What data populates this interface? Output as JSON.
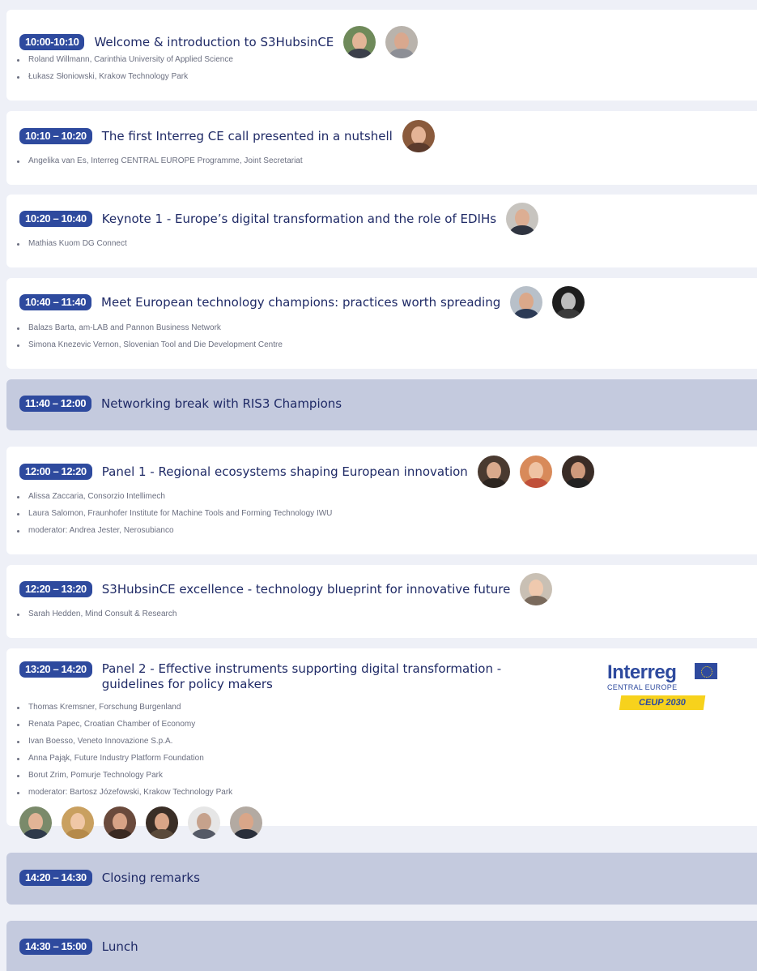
{
  "colors": {
    "accent": "#2e4a9e",
    "title": "#1f2a66",
    "break_bg": "#c4cade",
    "page_bg": "#eef0f7",
    "logo_yellow": "#f7d21c"
  },
  "sessions": [
    {
      "time": "10:00-10:10",
      "title": "Welcome & introduction to S3HubsinCE",
      "speakers": [
        "Roland Willmann, Carinthia University of Applied Science",
        "Łukasz Słoniowski, Krakow Technology Park"
      ]
    },
    {
      "time": "10:10 – 10:20",
      "title": "The first Interreg CE call presented in a nutshell",
      "speakers": [
        "Angelika van Es, Interreg CENTRAL EUROPE Programme, Joint Secretariat"
      ]
    },
    {
      "time": "10:20 – 10:40",
      "title": "Keynote 1 - Europe’s digital transformation and the role of EDIHs",
      "speakers": [
        "Mathias Kuom DG Connect"
      ]
    },
    {
      "time": "10:40 – 11:40",
      "title": "Meet European technology champions: practices worth spreading",
      "speakers": [
        "Balazs Barta, am-LAB and Pannon Business Network",
        "Simona Knezevic Vernon, Slovenian Tool and Die Development Centre"
      ]
    },
    {
      "time": "11:40 – 12:00",
      "title": "Networking break with RIS3 Champions",
      "speakers": []
    },
    {
      "time": "12:00 – 12:20",
      "title": "Panel 1 - Regional ecosystems shaping European innovation",
      "speakers": [
        "Alissa Zaccaria, Consorzio Intellimech",
        "Laura Salomon, Fraunhofer Institute for Machine Tools and Forming Technology IWU",
        "moderator: Andrea Jester, Nerosubianco"
      ]
    },
    {
      "time": "12:20 – 13:20",
      "title": "S3HubsinCE excellence - technology blueprint for innovative future",
      "speakers": [
        "Sarah Hedden, Mind Consult & Research"
      ]
    },
    {
      "time": "13:20 – 14:20",
      "title": "Panel 2 - Effective instruments supporting digital transformation - guidelines for policy makers",
      "speakers": [
        "Thomas Kremsner, Forschung Burgenland",
        "Renata Papec, Croatian Chamber of Economy",
        "Ivan Boesso, Veneto Innovazione S.p.A.",
        "Anna Pająk, Future Industry Platform Foundation",
        "Borut Zrim, Pomurje Technology Park",
        "moderator: Bartosz Józefowski, Krakow Technology Park"
      ]
    },
    {
      "time": "14:20 – 14:30",
      "title": "Closing remarks",
      "speakers": []
    },
    {
      "time": "14:30 – 15:00",
      "title": "Lunch",
      "speakers": []
    }
  ],
  "logo": {
    "brand": "Interreg",
    "program": "CENTRAL EUROPE",
    "tag": "CEUP 2030"
  }
}
